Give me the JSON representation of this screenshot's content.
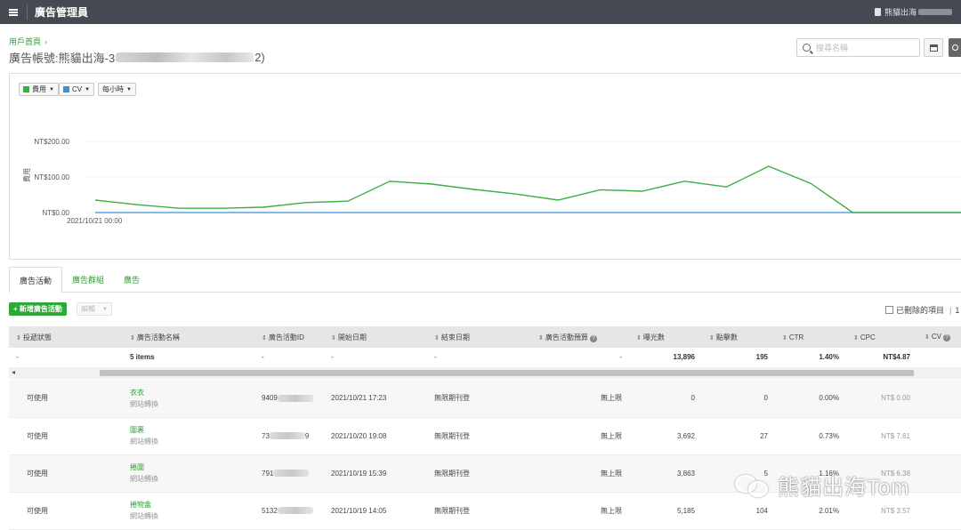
{
  "topbar": {
    "title": "廣告管理員",
    "account_label": "熊貓出海"
  },
  "breadcrumb": {
    "home": "用戶首頁"
  },
  "account_header": {
    "prefix": "廣告帳號: ",
    "name_start": "熊貓出海-3",
    "name_end": "2)"
  },
  "search": {
    "placeholder": "搜尋名稱"
  },
  "chart_controls": {
    "metric1": "費用",
    "metric1_color": "#3cae45",
    "metric2": "CV",
    "metric2_color": "#3a8fd9",
    "granularity": "每小時"
  },
  "chart_data": {
    "type": "line",
    "ylabel": "費用",
    "y_ticks": [
      "NT$0.00",
      "NT$100.00",
      "NT$200.00"
    ],
    "ylim": [
      0,
      200
    ],
    "x_start_label": "2021/10/21 00:00",
    "grid": true,
    "series": [
      {
        "name": "費用",
        "color": "#3cae45",
        "values": [
          35,
          22,
          12,
          12,
          15,
          28,
          32,
          88,
          80,
          65,
          52,
          35,
          64,
          60,
          88,
          72,
          130,
          82,
          0,
          0,
          0,
          0
        ]
      },
      {
        "name": "CV",
        "color": "#3a8fd9",
        "values": [
          0,
          0,
          0,
          0,
          0,
          0,
          0,
          0,
          0,
          0,
          0,
          0,
          0,
          0,
          0,
          0,
          0,
          0,
          0,
          0,
          0,
          0
        ]
      }
    ]
  },
  "tabs": [
    "廣告活動",
    "廣告群組",
    "廣告"
  ],
  "toolbar": {
    "new_label": "+ 新增廣告活動",
    "edit_label": "編輯",
    "show_deleted": "已刪除的項目",
    "trailing": "1"
  },
  "table": {
    "headers": [
      "投遞狀態",
      "廣告活動名稱",
      "廣告活動ID",
      "開始日期",
      "結束日期",
      "廣告活動預算",
      "曝光數",
      "點擊數",
      "CTR",
      "CPC",
      "CV"
    ],
    "summary": {
      "status": "-",
      "name": "5 items",
      "id": "-",
      "start": "-",
      "end": "-",
      "budget": "-",
      "impressions": "13,896",
      "clicks": "195",
      "ctr": "1.40%",
      "cpc": "NT$4.87",
      "cv": ""
    },
    "rows": [
      {
        "status": "可使用",
        "name": "衣衣",
        "objective": "網站轉換",
        "id_start": "9409",
        "id_end": "",
        "start": "2021/10/21 17:23",
        "end": "無限期刊登",
        "budget": "無上限",
        "impressions": "0",
        "clicks": "0",
        "ctr": "0.00%",
        "cpc": "NT$ 0.00"
      },
      {
        "status": "可使用",
        "name": "圍裹",
        "objective": "網站轉換",
        "id_start": "73",
        "id_end": "9",
        "start": "2021/10/20 19:08",
        "end": "無限期刊登",
        "budget": "無上限",
        "impressions": "3,692",
        "clicks": "27",
        "ctr": "0.73%",
        "cpc": "NT$ 7.61"
      },
      {
        "status": "可使用",
        "name": "捲圍",
        "objective": "網站轉換",
        "id_start": "791",
        "id_end": "",
        "start": "2021/10/19 15:39",
        "end": "無限期刊登",
        "budget": "無上限",
        "impressions": "3,863",
        "clicks": "5",
        "ctr": "1.16%",
        "cpc": "NT$ 6.38"
      },
      {
        "status": "可使用",
        "name": "捲物盒",
        "objective": "網站轉換",
        "id_start": "5132",
        "id_end": "",
        "start": "2021/10/19 14:05",
        "end": "無限期刊登",
        "budget": "無上限",
        "impressions": "5,185",
        "clicks": "104",
        "ctr": "2.01%",
        "cpc": "NT$ 3.57"
      }
    ]
  },
  "watermark": "熊貓出海Tom"
}
